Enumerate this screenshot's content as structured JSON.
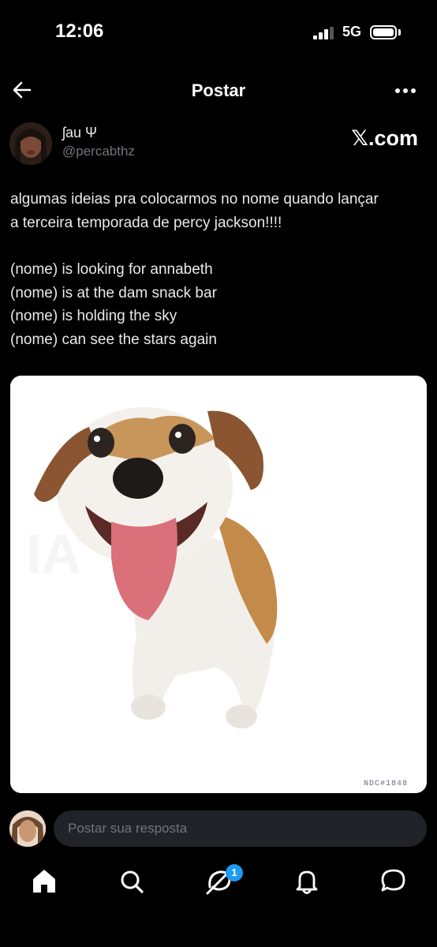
{
  "status_bar": {
    "time": "12:06",
    "network": "5G"
  },
  "header": {
    "title": "Postar"
  },
  "author": {
    "name": "ʃau Ψ",
    "handle": "@percabthz"
  },
  "source": {
    "label": "𝕏.com"
  },
  "post": {
    "lines_intro": [
      "algumas ideias pra colocarmos no nome quando lançar",
      "a terceira temporada de percy jackson!!!!"
    ],
    "lines_list": [
      "(nome) is looking for annabeth",
      "(nome) is at the dam snack bar",
      "(nome) is holding the sky",
      "(nome) can see the stars again"
    ],
    "image_watermark": "NDC#1848"
  },
  "reply": {
    "placeholder": "Postar sua resposta"
  },
  "nav": {
    "notifications_count": "1",
    "items": [
      "home-icon",
      "search-icon",
      "grok-icon",
      "notifications-bell-icon",
      "messages-icon"
    ]
  },
  "colors": {
    "accent": "#1d9bf0",
    "background": "#000000",
    "muted": "#71767b",
    "input_bg": "#202327"
  }
}
